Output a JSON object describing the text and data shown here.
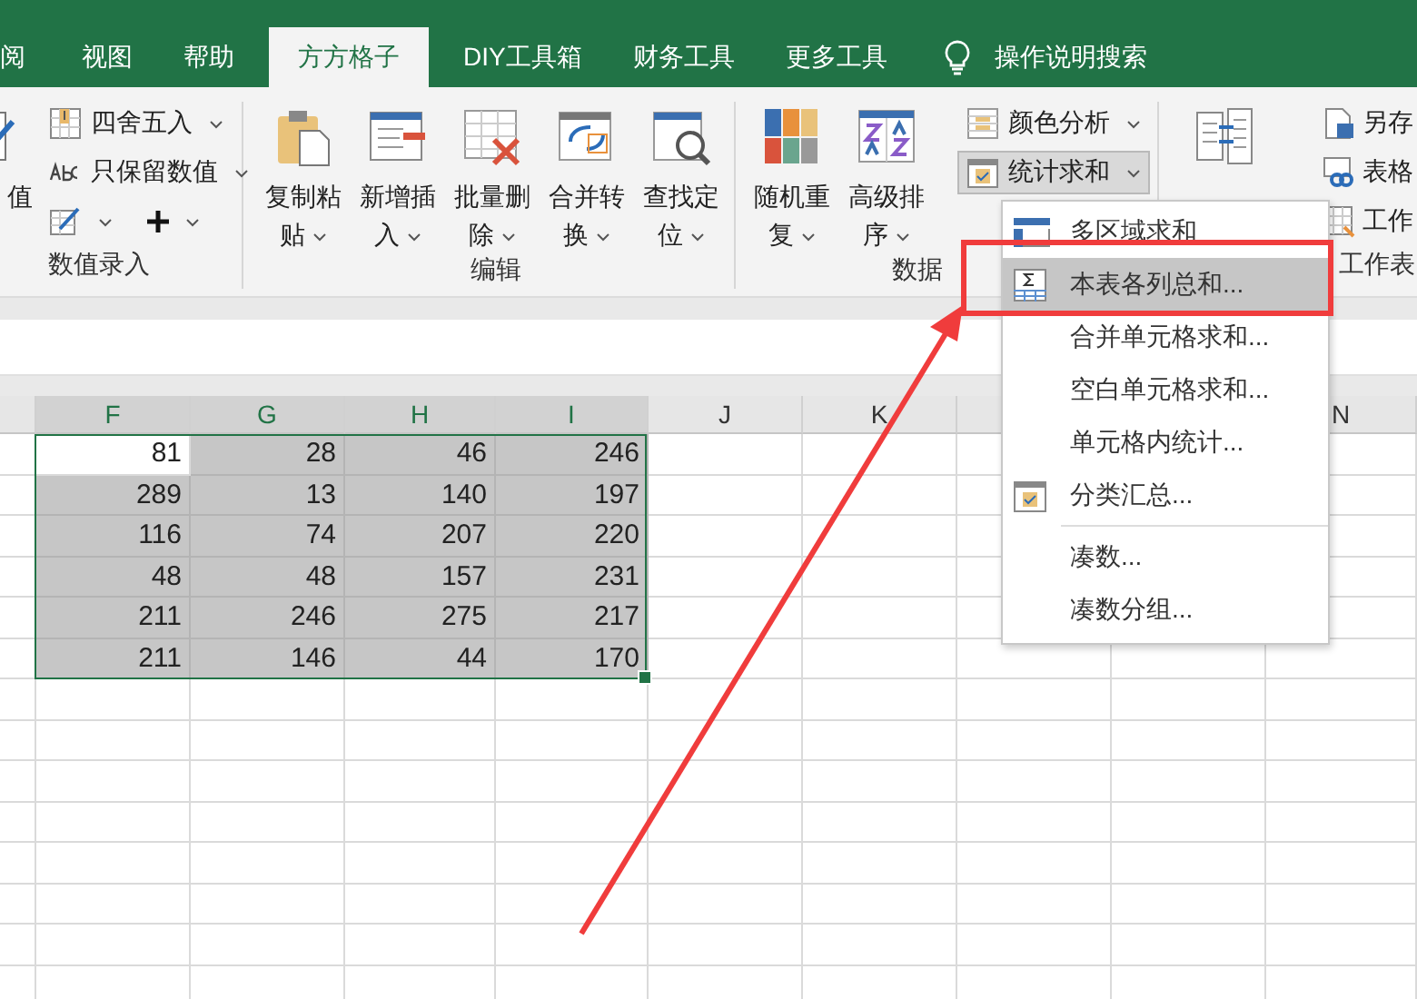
{
  "ribbon_tabs": [
    {
      "label": "阅",
      "selected": false
    },
    {
      "label": "视图",
      "selected": false
    },
    {
      "label": "帮助",
      "selected": false
    },
    {
      "label": "方方格子",
      "selected": true
    },
    {
      "label": "DIY工具箱",
      "selected": false
    },
    {
      "label": "财务工具",
      "selected": false
    },
    {
      "label": "更多工具",
      "selected": false
    }
  ],
  "tell_me": {
    "label": "操作说明搜索"
  },
  "ribbon_groups": [
    {
      "label": "数值录入",
      "large_buttons": [
        {
          "kind": "check",
          "label": "值"
        }
      ],
      "small_buttons": [
        {
          "kind": "round",
          "label": "四舍五入",
          "caret": true,
          "pressed": false
        },
        {
          "kind": "abc",
          "label": "只保留数值",
          "caret": true,
          "pressed": false
        },
        {
          "kind": "tools",
          "caret": true,
          "pressed": false
        }
      ]
    },
    {
      "label": "编辑",
      "large_buttons": [
        {
          "kind": "paste",
          "label": "复制粘贴",
          "caret": true
        },
        {
          "kind": "insert",
          "label": "新增插入",
          "caret": true
        },
        {
          "kind": "delete",
          "label": "批量删除",
          "caret": true
        },
        {
          "kind": "merge",
          "label": "合并转换",
          "caret": true
        },
        {
          "kind": "find",
          "label": "查找定位",
          "caret": true
        }
      ]
    },
    {
      "label": "数据",
      "large_buttons": [
        {
          "kind": "random",
          "label": "随机重复",
          "caret": true
        },
        {
          "kind": "sort",
          "label": "高级排序",
          "caret": true
        }
      ],
      "small_buttons": [
        {
          "kind": "color",
          "label": "颜色分析",
          "caret": true,
          "pressed": false
        },
        {
          "kind": "stats",
          "label": "统计求和",
          "caret": true,
          "pressed": true
        }
      ]
    },
    {
      "label": "工作表",
      "large_buttons": [
        {
          "kind": "summary"
        }
      ],
      "small_buttons": [
        {
          "kind": "save",
          "label": "另存",
          "pressed": false
        },
        {
          "kind": "link",
          "label": "表格",
          "pressed": false
        },
        {
          "kind": "sheet",
          "label": "工作",
          "pressed": false
        }
      ]
    }
  ],
  "sheet": {
    "column_headers": [
      {
        "label": "F",
        "selected": true
      },
      {
        "label": "G",
        "selected": true
      },
      {
        "label": "H",
        "selected": true
      },
      {
        "label": "I",
        "selected": true
      },
      {
        "label": "J",
        "selected": false
      },
      {
        "label": "K",
        "selected": false
      }
    ],
    "far_column_header": {
      "label": "N",
      "selected": false
    },
    "rows": [
      {
        "cells": [
          {
            "text": "81",
            "active": true
          },
          {
            "text": "28",
            "active": false
          },
          {
            "text": "46",
            "active": false
          },
          {
            "text": "246",
            "active": false
          }
        ]
      },
      {
        "cells": [
          {
            "text": "289",
            "active": false
          },
          {
            "text": "13",
            "active": false
          },
          {
            "text": "140",
            "active": false
          },
          {
            "text": "197",
            "active": false
          }
        ]
      },
      {
        "cells": [
          {
            "text": "116",
            "active": false
          },
          {
            "text": "74",
            "active": false
          },
          {
            "text": "207",
            "active": false
          },
          {
            "text": "220",
            "active": false
          }
        ]
      },
      {
        "cells": [
          {
            "text": "48",
            "active": false
          },
          {
            "text": "48",
            "active": false
          },
          {
            "text": "157",
            "active": false
          },
          {
            "text": "231",
            "active": false
          }
        ]
      },
      {
        "cells": [
          {
            "text": "211",
            "active": false
          },
          {
            "text": "246",
            "active": false
          },
          {
            "text": "275",
            "active": false
          },
          {
            "text": "217",
            "active": false
          }
        ]
      },
      {
        "cells": [
          {
            "text": "211",
            "active": false
          },
          {
            "text": "146",
            "active": false
          },
          {
            "text": "44",
            "active": false
          },
          {
            "text": "170",
            "active": false
          }
        ]
      }
    ]
  },
  "dropdown_menu": {
    "items": [
      {
        "kind": "multi",
        "label": "多区域求和",
        "selected": false,
        "separator_above": false
      },
      {
        "kind": "columns",
        "label": "本表各列总和...",
        "selected": true,
        "separator_above": false
      },
      {
        "kind": "plain",
        "label": "合并单元格求和...",
        "selected": false,
        "separator_above": false
      },
      {
        "kind": "plain",
        "label": "空白单元格求和...",
        "selected": false,
        "separator_above": false
      },
      {
        "kind": "plain",
        "label": "单元格内统计...",
        "selected": false,
        "separator_above": false
      },
      {
        "kind": "subtotal",
        "label": "分类汇总...",
        "selected": false,
        "separator_above": false
      },
      {
        "kind": "plain",
        "label": "凑数...",
        "selected": false,
        "separator_above": true
      },
      {
        "kind": "plain",
        "label": "凑数分组...",
        "selected": false,
        "separator_above": false
      }
    ]
  }
}
